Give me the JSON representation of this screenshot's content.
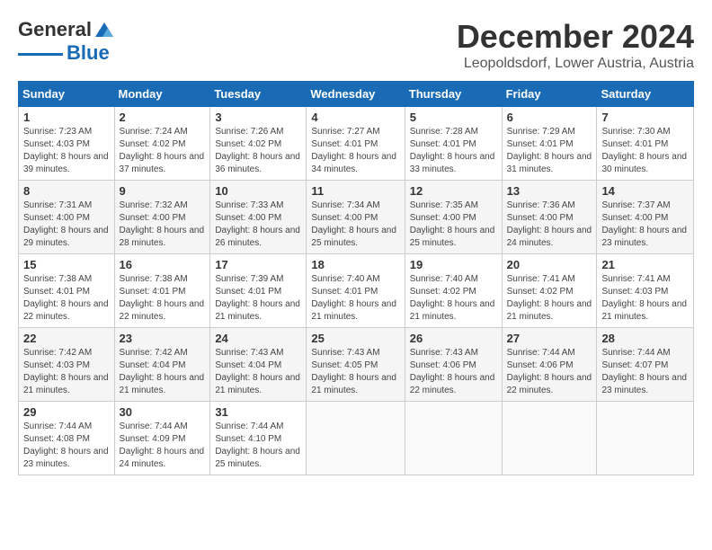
{
  "logo": {
    "text_general": "General",
    "text_blue": "Blue"
  },
  "header": {
    "month": "December 2024",
    "location": "Leopoldsdorf, Lower Austria, Austria"
  },
  "weekdays": [
    "Sunday",
    "Monday",
    "Tuesday",
    "Wednesday",
    "Thursday",
    "Friday",
    "Saturday"
  ],
  "weeks": [
    [
      {
        "day": "1",
        "sunrise": "7:23 AM",
        "sunset": "4:03 PM",
        "daylight": "8 hours and 39 minutes."
      },
      {
        "day": "2",
        "sunrise": "7:24 AM",
        "sunset": "4:02 PM",
        "daylight": "8 hours and 37 minutes."
      },
      {
        "day": "3",
        "sunrise": "7:26 AM",
        "sunset": "4:02 PM",
        "daylight": "8 hours and 36 minutes."
      },
      {
        "day": "4",
        "sunrise": "7:27 AM",
        "sunset": "4:01 PM",
        "daylight": "8 hours and 34 minutes."
      },
      {
        "day": "5",
        "sunrise": "7:28 AM",
        "sunset": "4:01 PM",
        "daylight": "8 hours and 33 minutes."
      },
      {
        "day": "6",
        "sunrise": "7:29 AM",
        "sunset": "4:01 PM",
        "daylight": "8 hours and 31 minutes."
      },
      {
        "day": "7",
        "sunrise": "7:30 AM",
        "sunset": "4:01 PM",
        "daylight": "8 hours and 30 minutes."
      }
    ],
    [
      {
        "day": "8",
        "sunrise": "7:31 AM",
        "sunset": "4:00 PM",
        "daylight": "8 hours and 29 minutes."
      },
      {
        "day": "9",
        "sunrise": "7:32 AM",
        "sunset": "4:00 PM",
        "daylight": "8 hours and 28 minutes."
      },
      {
        "day": "10",
        "sunrise": "7:33 AM",
        "sunset": "4:00 PM",
        "daylight": "8 hours and 26 minutes."
      },
      {
        "day": "11",
        "sunrise": "7:34 AM",
        "sunset": "4:00 PM",
        "daylight": "8 hours and 25 minutes."
      },
      {
        "day": "12",
        "sunrise": "7:35 AM",
        "sunset": "4:00 PM",
        "daylight": "8 hours and 25 minutes."
      },
      {
        "day": "13",
        "sunrise": "7:36 AM",
        "sunset": "4:00 PM",
        "daylight": "8 hours and 24 minutes."
      },
      {
        "day": "14",
        "sunrise": "7:37 AM",
        "sunset": "4:00 PM",
        "daylight": "8 hours and 23 minutes."
      }
    ],
    [
      {
        "day": "15",
        "sunrise": "7:38 AM",
        "sunset": "4:01 PM",
        "daylight": "8 hours and 22 minutes."
      },
      {
        "day": "16",
        "sunrise": "7:38 AM",
        "sunset": "4:01 PM",
        "daylight": "8 hours and 22 minutes."
      },
      {
        "day": "17",
        "sunrise": "7:39 AM",
        "sunset": "4:01 PM",
        "daylight": "8 hours and 21 minutes."
      },
      {
        "day": "18",
        "sunrise": "7:40 AM",
        "sunset": "4:01 PM",
        "daylight": "8 hours and 21 minutes."
      },
      {
        "day": "19",
        "sunrise": "7:40 AM",
        "sunset": "4:02 PM",
        "daylight": "8 hours and 21 minutes."
      },
      {
        "day": "20",
        "sunrise": "7:41 AM",
        "sunset": "4:02 PM",
        "daylight": "8 hours and 21 minutes."
      },
      {
        "day": "21",
        "sunrise": "7:41 AM",
        "sunset": "4:03 PM",
        "daylight": "8 hours and 21 minutes."
      }
    ],
    [
      {
        "day": "22",
        "sunrise": "7:42 AM",
        "sunset": "4:03 PM",
        "daylight": "8 hours and 21 minutes."
      },
      {
        "day": "23",
        "sunrise": "7:42 AM",
        "sunset": "4:04 PM",
        "daylight": "8 hours and 21 minutes."
      },
      {
        "day": "24",
        "sunrise": "7:43 AM",
        "sunset": "4:04 PM",
        "daylight": "8 hours and 21 minutes."
      },
      {
        "day": "25",
        "sunrise": "7:43 AM",
        "sunset": "4:05 PM",
        "daylight": "8 hours and 21 minutes."
      },
      {
        "day": "26",
        "sunrise": "7:43 AM",
        "sunset": "4:06 PM",
        "daylight": "8 hours and 22 minutes."
      },
      {
        "day": "27",
        "sunrise": "7:44 AM",
        "sunset": "4:06 PM",
        "daylight": "8 hours and 22 minutes."
      },
      {
        "day": "28",
        "sunrise": "7:44 AM",
        "sunset": "4:07 PM",
        "daylight": "8 hours and 23 minutes."
      }
    ],
    [
      {
        "day": "29",
        "sunrise": "7:44 AM",
        "sunset": "4:08 PM",
        "daylight": "8 hours and 23 minutes."
      },
      {
        "day": "30",
        "sunrise": "7:44 AM",
        "sunset": "4:09 PM",
        "daylight": "8 hours and 24 minutes."
      },
      {
        "day": "31",
        "sunrise": "7:44 AM",
        "sunset": "4:10 PM",
        "daylight": "8 hours and 25 minutes."
      },
      null,
      null,
      null,
      null
    ]
  ]
}
